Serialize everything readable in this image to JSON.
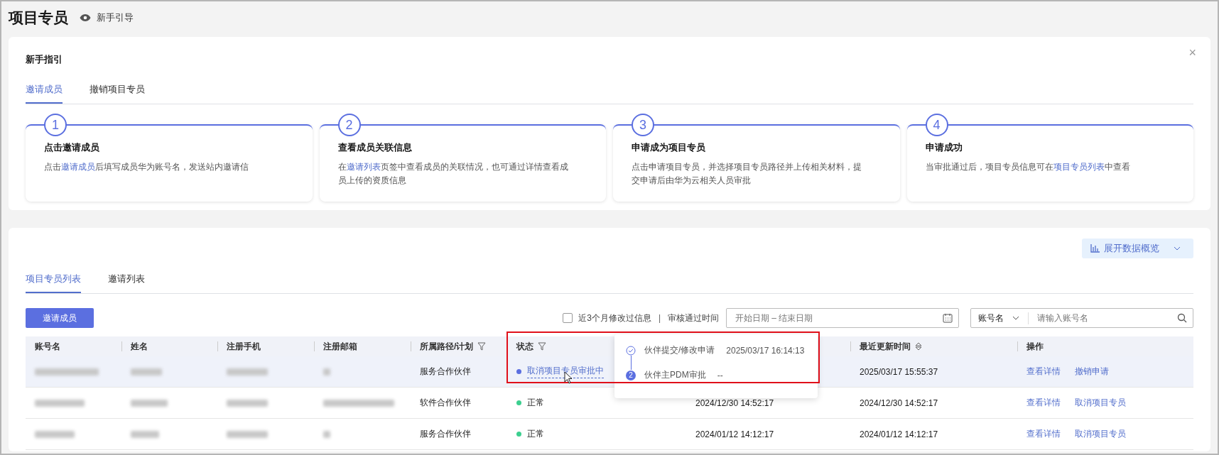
{
  "page": {
    "title": "项目专员",
    "guide_link": "新手引导"
  },
  "guide": {
    "title": "新手指引",
    "close": "×",
    "tabs": [
      {
        "label": "邀请成员",
        "selected": true
      },
      {
        "label": "撤销项目专员",
        "selected": false
      }
    ],
    "steps": [
      {
        "number": "1",
        "title": "点击邀请成员",
        "desc": [
          {
            "text": "点击"
          },
          {
            "text": "邀请成员",
            "link": true
          },
          {
            "text": "后填写成员华为账号名，发送站内邀请信"
          }
        ]
      },
      {
        "number": "2",
        "title": "查看成员关联信息",
        "desc": [
          {
            "text": "在"
          },
          {
            "text": "邀请列表",
            "link": true
          },
          {
            "text": "页签中查看成员的关联情况，也可通过详情查看成员上传的资质信息"
          }
        ]
      },
      {
        "number": "3",
        "title": "申请成为项目专员",
        "desc": [
          {
            "text": "点击申请项目专员，并选择项目专员路径并上传相关材料，提交申请后由华为云相关人员审批"
          }
        ]
      },
      {
        "number": "4",
        "title": "申请成功",
        "desc": [
          {
            "text": "当审批通过后，项目专员信息可在"
          },
          {
            "text": "项目专员列表",
            "link": true
          },
          {
            "text": "中查看"
          }
        ]
      }
    ]
  },
  "list": {
    "overview_button": "展开数据概览",
    "tabs": [
      {
        "label": "项目专员列表",
        "selected": true
      },
      {
        "label": "邀请列表",
        "selected": false
      }
    ],
    "invite_button": "邀请成员",
    "recent_filter": {
      "label": "近3个月修改过信息",
      "checked": false
    },
    "separator": "|",
    "date_label": "审核通过时间",
    "date_range": {
      "placeholder": "开始日期 – 结束日期"
    },
    "search": {
      "field": "账号名",
      "placeholder": "请输入账号名"
    },
    "columns": [
      {
        "label": "账号名"
      },
      {
        "label": "姓名"
      },
      {
        "label": "注册手机"
      },
      {
        "label": "注册邮箱"
      },
      {
        "label": "所属路径/计划",
        "filter": true
      },
      {
        "label": "状态",
        "filter": true
      },
      {},
      {
        "label": "最近更新时间",
        "sort": true
      },
      {
        "label": "操作"
      }
    ],
    "rows": [
      {
        "highlighted": true,
        "path": "服务合作伙伴",
        "status": {
          "text": "取消项目专员审批中",
          "kind": "link",
          "color": "#5b6fe0"
        },
        "updated": "2025/03/17 15:55:37",
        "actions": [
          "查看详情",
          "撤销申请"
        ]
      },
      {
        "highlighted": false,
        "path": "软件合作伙伴",
        "status": {
          "text": "正常",
          "kind": "plain",
          "color": "#3ccf8f"
        },
        "column_7": "2024/12/30 14:52:17",
        "updated": "2024/12/30 14:52:17",
        "actions": [
          "查看详情",
          "取消项目专员"
        ]
      },
      {
        "highlighted": false,
        "path": "服务合作伙伴",
        "status": {
          "text": "正常",
          "kind": "plain",
          "color": "#3ccf8f"
        },
        "column_7": "2024/01/12 14:12:17",
        "updated": "2024/01/12 14:12:17",
        "actions": [
          "查看详情",
          "取消项目专员"
        ]
      }
    ],
    "tooltip": {
      "steps": [
        {
          "kind": "done",
          "label": "伙伴提交/修改申请",
          "time": "2025/03/17 16:14:13"
        },
        {
          "kind": "current",
          "index": "2",
          "label": "伙伴主PDM审批",
          "time": "--"
        }
      ]
    }
  }
}
